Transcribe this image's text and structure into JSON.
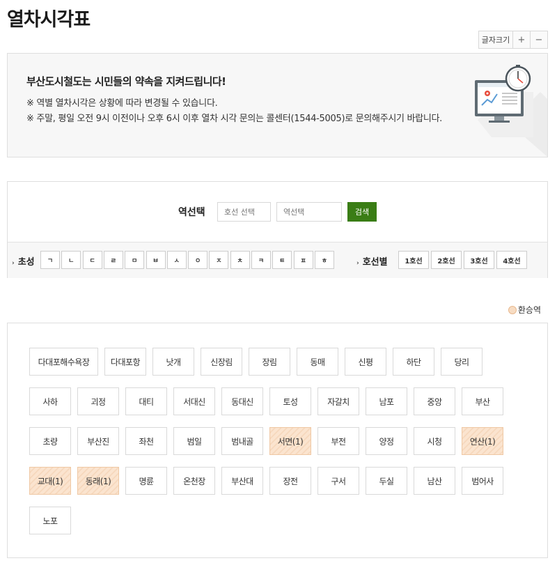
{
  "page": {
    "title": "열차시각표"
  },
  "fontsize": {
    "label": "글자크기",
    "plus": "+",
    "minus": "−"
  },
  "notice": {
    "title": "부산도시철도는 시민들의 약속을 지켜드립니다!",
    "line1": "※ 역별 열차시각은 상황에 따라 변경될 수 있습니다.",
    "line2": "※ 주말, 평일 오전 9시 이전이나 오후 6시 이후 열차 시각 문의는 콜센터(1544-5005)로 문의해주시기 바랍니다."
  },
  "search": {
    "label": "역선택",
    "line_placeholder": "호선 선택",
    "station_placeholder": "역선택",
    "button": "검색"
  },
  "filters": {
    "chosung_label": "초성",
    "chosung": [
      "ㄱ",
      "ㄴ",
      "ㄷ",
      "ㄹ",
      "ㅁ",
      "ㅂ",
      "ㅅ",
      "ㅇ",
      "ㅈ",
      "ㅊ",
      "ㅋ",
      "ㅌ",
      "ㅍ",
      "ㅎ"
    ],
    "line_label": "호선별",
    "lines": [
      "1호선",
      "2호선",
      "3호선",
      "4호선"
    ]
  },
  "legend": {
    "transfer": "환승역",
    "transfer_color": "#f7dcc3"
  },
  "stations": [
    {
      "name": "다대포해수욕장",
      "transfer": false
    },
    {
      "name": "다대포항",
      "transfer": false
    },
    {
      "name": "낫개",
      "transfer": false
    },
    {
      "name": "신장림",
      "transfer": false
    },
    {
      "name": "장림",
      "transfer": false
    },
    {
      "name": "동매",
      "transfer": false
    },
    {
      "name": "신평",
      "transfer": false
    },
    {
      "name": "하단",
      "transfer": false
    },
    {
      "name": "당리",
      "transfer": false
    },
    {
      "name": "사하",
      "transfer": false
    },
    {
      "name": "괴정",
      "transfer": false
    },
    {
      "name": "대티",
      "transfer": false
    },
    {
      "name": "서대신",
      "transfer": false
    },
    {
      "name": "동대신",
      "transfer": false
    },
    {
      "name": "토성",
      "transfer": false
    },
    {
      "name": "자갈치",
      "transfer": false
    },
    {
      "name": "남포",
      "transfer": false
    },
    {
      "name": "중앙",
      "transfer": false
    },
    {
      "name": "부산",
      "transfer": false
    },
    {
      "name": "초량",
      "transfer": false
    },
    {
      "name": "부산진",
      "transfer": false
    },
    {
      "name": "좌천",
      "transfer": false
    },
    {
      "name": "범일",
      "transfer": false
    },
    {
      "name": "범내골",
      "transfer": false
    },
    {
      "name": "서면(1)",
      "transfer": true
    },
    {
      "name": "부전",
      "transfer": false
    },
    {
      "name": "양정",
      "transfer": false
    },
    {
      "name": "시청",
      "transfer": false
    },
    {
      "name": "연산(1)",
      "transfer": true
    },
    {
      "name": "교대(1)",
      "transfer": true
    },
    {
      "name": "동래(1)",
      "transfer": true
    },
    {
      "name": "명륜",
      "transfer": false
    },
    {
      "name": "온천장",
      "transfer": false
    },
    {
      "name": "부산대",
      "transfer": false
    },
    {
      "name": "장전",
      "transfer": false
    },
    {
      "name": "구서",
      "transfer": false
    },
    {
      "name": "두실",
      "transfer": false
    },
    {
      "name": "남산",
      "transfer": false
    },
    {
      "name": "범어사",
      "transfer": false
    },
    {
      "name": "노포",
      "transfer": false
    }
  ]
}
